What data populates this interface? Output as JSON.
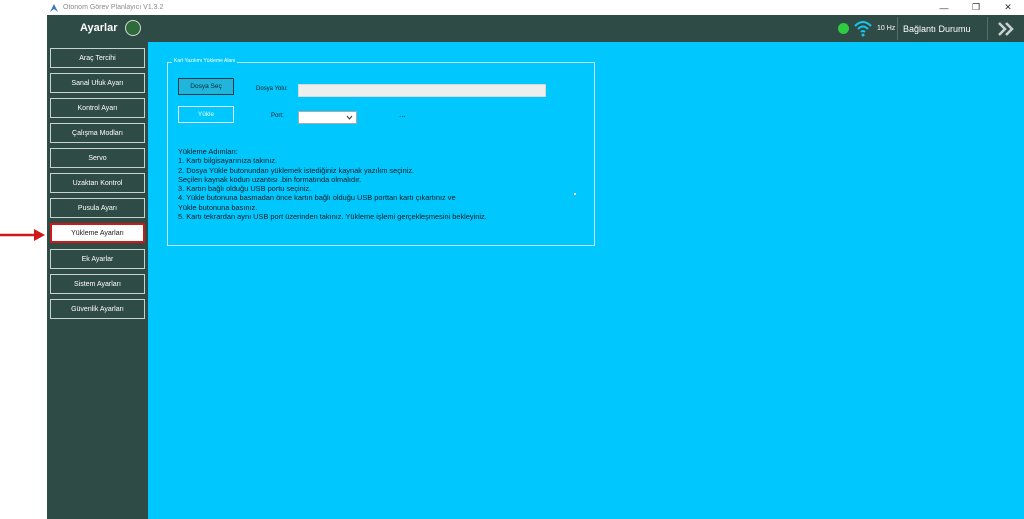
{
  "window": {
    "title": "Otonom Görev Planlayıcı V1.3.2",
    "controls": {
      "minimize": "—",
      "restore": "❐",
      "close": "✕"
    }
  },
  "header": {
    "title": "Ayarlar",
    "rate": "10 Hz",
    "connection_label": "Bağlantı Durumu",
    "status_color": "#2ecc40",
    "accent": "#00c8ff"
  },
  "sidebar": {
    "items": [
      {
        "label": "Araç Tercihi"
      },
      {
        "label": "Sanal Ufuk Ayarı"
      },
      {
        "label": "Kontrol Ayarı"
      },
      {
        "label": "Çalışma Modları"
      },
      {
        "label": "Servo"
      },
      {
        "label": "Uzaktan Kontrol"
      },
      {
        "label": "Pusula Ayarı"
      },
      {
        "label": "Yükleme Ayarları",
        "active": true
      },
      {
        "label": "Ek Ayarlar"
      },
      {
        "label": "Sistem Ayarları"
      },
      {
        "label": "Güvenlik Ayarları"
      }
    ]
  },
  "upload_panel": {
    "legend": "Kart Yazılımı Yükleme Alanı",
    "file_button": "Dosya Seç",
    "path_label": "Dosya Yolu:",
    "path_value": "",
    "upload_button": "Yükle",
    "port_label": "Port:",
    "port_value": "",
    "dots": "...",
    "steps": [
      "Yükleme Adımları:",
      "1. Kartı bilgisayarınıza takınız.",
      "2. Dosya Yükle butonundan yüklemek istediğiniz kaynak yazılım seçiniz.",
      "Seçilen kaynak kodun uzantısı .bin formatında olmalıdır.",
      "3. Kartın bağlı olduğu USB portu seçiniz.",
      "4. Yükle butonuna basmadan önce kartın bağlı olduğu USB porttan kartı çıkartınız ve",
      "Yükle butonuna basınız.",
      "5. Kartı tekrardan aynı USB port üzerinden takınız. Yükleme işlemi gerçekleşmesini bekleyiniz."
    ]
  }
}
